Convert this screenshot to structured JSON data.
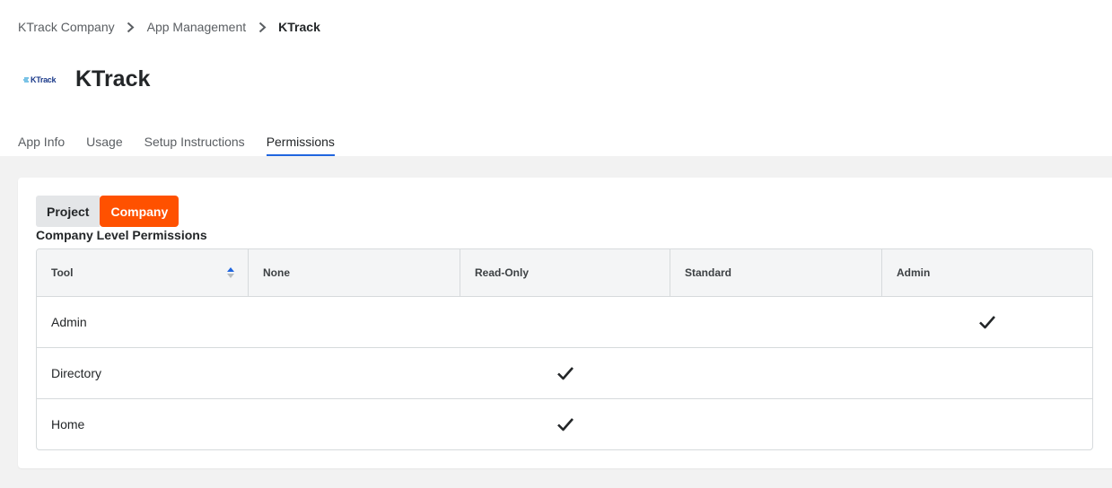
{
  "breadcrumb": {
    "items": [
      "KTrack Company",
      "App Management",
      "KTrack"
    ]
  },
  "app": {
    "logo_text": "KTrack",
    "title": "KTrack"
  },
  "tabs": [
    {
      "label": "App Info",
      "active": false
    },
    {
      "label": "Usage",
      "active": false
    },
    {
      "label": "Setup Instructions",
      "active": false
    },
    {
      "label": "Permissions",
      "active": true
    }
  ],
  "permissions": {
    "toggle": {
      "project_label": "Project",
      "company_label": "Company",
      "selected": "Company"
    },
    "section_title": "Company Level Permissions",
    "columns": [
      "Tool",
      "None",
      "Read-Only",
      "Standard",
      "Admin"
    ],
    "rows": [
      {
        "tool": "Admin",
        "level": "Admin"
      },
      {
        "tool": "Directory",
        "level": "Read-Only"
      },
      {
        "tool": "Home",
        "level": "Read-Only"
      }
    ]
  },
  "colors": {
    "accent_orange": "#ff5100",
    "active_tab_underline": "#2066df",
    "sort_icon_blue": "#2066df"
  },
  "icons": [
    "chevron-right-icon",
    "sort-icon",
    "checkmark-icon"
  ]
}
